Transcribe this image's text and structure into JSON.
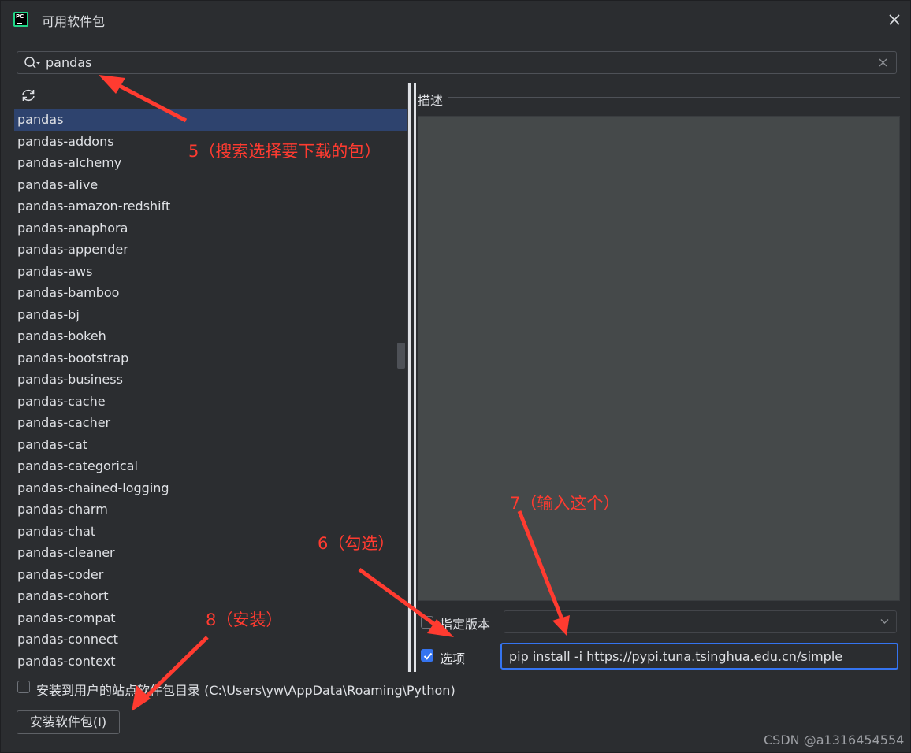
{
  "window": {
    "title": "可用软件包"
  },
  "search": {
    "value": "pandas"
  },
  "packages": [
    "pandas",
    "pandas-addons",
    "pandas-alchemy",
    "pandas-alive",
    "pandas-amazon-redshift",
    "pandas-anaphora",
    "pandas-appender",
    "pandas-aws",
    "pandas-bamboo",
    "pandas-bj",
    "pandas-bokeh",
    "pandas-bootstrap",
    "pandas-business",
    "pandas-cache",
    "pandas-cacher",
    "pandas-cat",
    "pandas-categorical",
    "pandas-chained-logging",
    "pandas-charm",
    "pandas-chat",
    "pandas-cleaner",
    "pandas-coder",
    "pandas-cohort",
    "pandas-compat",
    "pandas-connect",
    "pandas-context"
  ],
  "selected_index": 0,
  "description": {
    "label": "描述"
  },
  "version": {
    "label": "指定版本",
    "checked": false,
    "value": ""
  },
  "options": {
    "label": "选项",
    "checked": true,
    "value": "pip install -i https://pypi.tuna.tsinghua.edu.cn/simple"
  },
  "user_site": {
    "label": "安装到用户的站点软件包目录 (C:\\Users\\yw\\AppData\\Roaming\\Python)",
    "checked": false
  },
  "install_button": {
    "label": "安装软件包(I)"
  },
  "annotations": {
    "step5": "5（搜索选择要下载的包）",
    "step6": "6（勾选）",
    "step7": "7（输入这个）",
    "step8": "8（安装）"
  },
  "watermark": "CSDN @a1316454554",
  "colors": {
    "accent": "#3574f0",
    "annotation": "#ff3b30",
    "selection": "#2e436e"
  },
  "icons": {
    "app": "pycharm-icon",
    "close": "close-icon",
    "search": "search-icon",
    "clear": "clear-icon",
    "refresh": "refresh-icon",
    "dropdown": "chevron-down-icon"
  }
}
